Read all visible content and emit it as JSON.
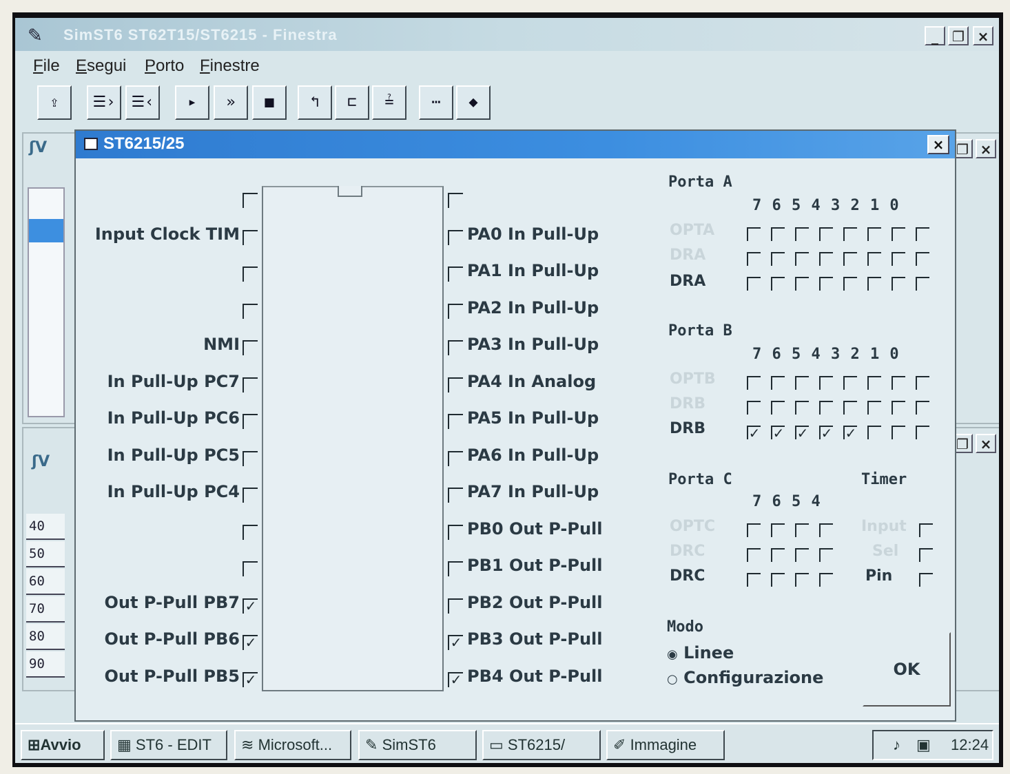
{
  "app": {
    "title": "SimST6 ST62T15/ST6215 - Finestra"
  },
  "menu": [
    "File",
    "Esegui",
    "Porto",
    "Finestre"
  ],
  "toolbar": {
    "icons": [
      "open-icon",
      "step-into-icon",
      "step-out-icon",
      "run-icon",
      "fast-run-icon",
      "stop-icon",
      "reg-icon",
      "mem-icon",
      "port-icon",
      "trace-icon",
      "breakpoint-icon"
    ]
  },
  "background_window": {
    "rows": [
      "40",
      "50",
      "60",
      "70",
      "80",
      "90"
    ]
  },
  "dialog": {
    "title": "ST6215/25",
    "left_pins": [
      {
        "label": "",
        "checked": false
      },
      {
        "label": "Input Clock  TIM",
        "checked": false
      },
      {
        "label": "",
        "checked": false
      },
      {
        "label": "",
        "checked": false
      },
      {
        "label": "NMI",
        "checked": false
      },
      {
        "label": "In Pull-Up  PC7",
        "checked": false
      },
      {
        "label": "In Pull-Up  PC6",
        "checked": false
      },
      {
        "label": "In Pull-Up  PC5",
        "checked": false
      },
      {
        "label": "In Pull-Up  PC4",
        "checked": false
      },
      {
        "label": "",
        "checked": false
      },
      {
        "label": "",
        "checked": false
      },
      {
        "label": "Out P-Pull  PB7",
        "checked": true
      },
      {
        "label": "Out P-Pull  PB6",
        "checked": true
      },
      {
        "label": "Out P-Pull  PB5",
        "checked": true
      }
    ],
    "right_pins": [
      {
        "label": "",
        "checked": false
      },
      {
        "label": "PA0 In Pull-Up",
        "checked": false
      },
      {
        "label": "PA1 In Pull-Up",
        "checked": false
      },
      {
        "label": "PA2 In Pull-Up",
        "checked": false
      },
      {
        "label": "PA3 In Pull-Up",
        "checked": false
      },
      {
        "label": "PA4 In Analog",
        "checked": false
      },
      {
        "label": "PA5 In Pull-Up",
        "checked": false
      },
      {
        "label": "PA6 In Pull-Up",
        "checked": false
      },
      {
        "label": "PA7 In Pull-Up",
        "checked": false
      },
      {
        "label": "PB0 Out P-Pull",
        "checked": false
      },
      {
        "label": "PB1 Out P-Pull",
        "checked": false
      },
      {
        "label": "PB2 Out P-Pull",
        "checked": false
      },
      {
        "label": "PB3 Out P-Pull",
        "checked": true
      },
      {
        "label": "PB4 Out P-Pull",
        "checked": true
      }
    ],
    "porta_a": {
      "title": "Porta A",
      "bits": "7 6 5 4 3 2 1 0",
      "ddr_label": "DRA"
    },
    "porta_b": {
      "title": "Porta B",
      "bits": "7 6 5 4 3 2 1 0",
      "ddr_label": "DRB",
      "ddr_checked": [
        true,
        true,
        true,
        true,
        true,
        false,
        false,
        false
      ]
    },
    "porta_c": {
      "title": "Porta C",
      "bits": "7 6 5 4",
      "ddr_label": "DRC"
    },
    "timer": {
      "title": "Timer",
      "pin_label": "Pin"
    },
    "modo": {
      "title": "Modo",
      "options": [
        "Linee",
        "Configurazione"
      ],
      "selected": "Linee"
    },
    "ok_label": "OK"
  },
  "taskbar": {
    "start": "Avvio",
    "tasks": [
      "ST6 - EDIT",
      "Microsoft...",
      "SimST6",
      "ST6215/",
      "Immagine"
    ],
    "clock": "12:24"
  }
}
